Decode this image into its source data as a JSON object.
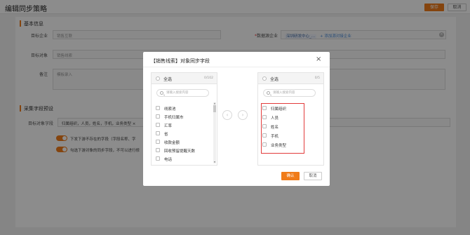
{
  "header": {
    "title": "编辑同步策略",
    "save_label": "保存",
    "cancel_label": "取消"
  },
  "form": {
    "basic_section": "基本信息",
    "target_company_label": "目标企业",
    "target_company_value": "销售互联",
    "data_source_label": "数据源企业",
    "data_source_value": "深圳研发中心_…",
    "data_source_link": "+ 添加源对接企业",
    "target_object_label": "目标对象",
    "target_object_value": "销售线索",
    "remark_label": "备注",
    "remark_placeholder": "模板录入",
    "preset_section": "采集字段预设",
    "target_fields_label": "目标对象字段",
    "target_fields_value": "归属组织，人员，姓名，手机，业务类型 ×",
    "toggle1_text": "下发下游不存在的字段（字段名称、字",
    "toggle2_text": "勾选下游对象的同步字段，不可以进行修"
  },
  "modal": {
    "title": "【销售线索】对象同步字段",
    "close_glyph": "×",
    "left_panel": {
      "select_all": "全选",
      "count": "0/102",
      "search_placeholder": "请输入搜索内容",
      "items": [
        "线索池",
        "手机归属市",
        "汇率",
        "省",
        "收款金额",
        "回收预留提醒天数",
        "电话"
      ]
    },
    "right_panel": {
      "select_all": "全选",
      "count": "0/5",
      "search_placeholder": "请输入搜索内容",
      "items": [
        "归属组织",
        "人员",
        "姓名",
        "手机",
        "业务类型"
      ]
    },
    "left_arrow": "‹",
    "right_arrow": "›",
    "confirm_label": "确认",
    "cancel_label": "取消"
  },
  "colors": {
    "accent": "#f07c1a",
    "highlight_box": "#e23b3b",
    "link": "#4a8bd8"
  }
}
